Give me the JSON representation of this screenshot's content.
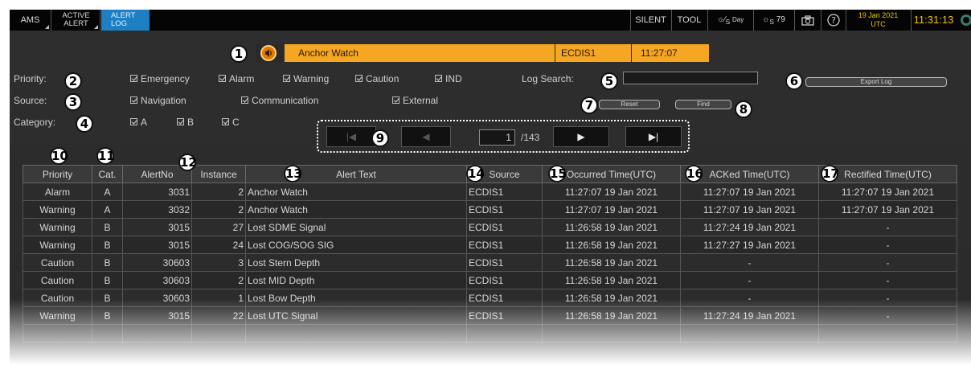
{
  "topbar": {
    "tabs": [
      {
        "label": "AMS"
      },
      {
        "label": "ACTIVE ALERT"
      },
      {
        "label": "ALERT LOG"
      }
    ],
    "silent_label": "SILENT",
    "tool_label": "TOOL",
    "day_label": "Day",
    "day_sub": "S",
    "brightness_value": "79",
    "brightness_sub": "S",
    "date": "19 Jan 2021",
    "tz": "UTC",
    "time": "11:31:13"
  },
  "latest_alert": {
    "text": "Anchor Watch",
    "source": "ECDIS1",
    "time": "11:27:07"
  },
  "filters": {
    "priority_label": "Priority:",
    "source_label": "Source:",
    "category_label": "Category:",
    "priority_options": [
      "Emergency",
      "Alarm",
      "Warning",
      "Caution",
      "IND"
    ],
    "source_options": [
      "Navigation",
      "Communication",
      "External"
    ],
    "category_options": [
      "A",
      "B",
      "C"
    ],
    "log_search_label": "Log Search:",
    "log_search_value": "",
    "export_label": "Export Log",
    "reset_label": "Reset",
    "find_label": "Find"
  },
  "pager": {
    "page": "1",
    "total": "/143",
    "first_glyph": "|◀",
    "prev_glyph": "◀",
    "next_glyph": "▶",
    "last_glyph": "▶|"
  },
  "callouts": [
    "1",
    "2",
    "3",
    "4",
    "5",
    "6",
    "7",
    "8",
    "9",
    "10",
    "11",
    "12",
    "13",
    "14",
    "15",
    "16",
    "17"
  ],
  "table": {
    "headers": [
      "Priority",
      "Cat.",
      "AlertNo",
      "Instance",
      "Alert Text",
      "Source",
      "Occurred Time(UTC)",
      "ACKed Time(UTC)",
      "Rectified Time(UTC)"
    ],
    "rows": [
      {
        "priority": "Alarm",
        "cat": "A",
        "alert_no": "3031",
        "instance": "2",
        "text": "Anchor Watch",
        "source": "ECDIS1",
        "occurred": "11:27:07 19 Jan 2021",
        "acked": "11:27:07 19 Jan 2021",
        "rectified": "11:27:07 19 Jan 2021"
      },
      {
        "priority": "Warning",
        "cat": "A",
        "alert_no": "3032",
        "instance": "2",
        "text": "Anchor Watch",
        "source": "ECDIS1",
        "occurred": "11:27:07 19 Jan 2021",
        "acked": "11:27:07 19 Jan 2021",
        "rectified": "11:27:07 19 Jan 2021"
      },
      {
        "priority": "Warning",
        "cat": "B",
        "alert_no": "3015",
        "instance": "27",
        "text": "Lost SDME Signal",
        "source": "ECDIS1",
        "occurred": "11:26:58 19 Jan 2021",
        "acked": "11:27:24 19 Jan 2021",
        "rectified": "-"
      },
      {
        "priority": "Warning",
        "cat": "B",
        "alert_no": "3015",
        "instance": "24",
        "text": "Lost COG/SOG SIG",
        "source": "ECDIS1",
        "occurred": "11:26:58 19 Jan 2021",
        "acked": "11:27:27 19 Jan 2021",
        "rectified": "-"
      },
      {
        "priority": "Caution",
        "cat": "B",
        "alert_no": "30603",
        "instance": "3",
        "text": "Lost Stern Depth",
        "source": "ECDIS1",
        "occurred": "11:26:58 19 Jan 2021",
        "acked": "-",
        "rectified": "-"
      },
      {
        "priority": "Caution",
        "cat": "B",
        "alert_no": "30603",
        "instance": "2",
        "text": "Lost MID Depth",
        "source": "ECDIS1",
        "occurred": "11:26:58 19 Jan 2021",
        "acked": "-",
        "rectified": "-"
      },
      {
        "priority": "Caution",
        "cat": "B",
        "alert_no": "30603",
        "instance": "1",
        "text": "Lost Bow Depth",
        "source": "ECDIS1",
        "occurred": "11:26:58 19 Jan 2021",
        "acked": "-",
        "rectified": "-"
      },
      {
        "priority": "Warning",
        "cat": "B",
        "alert_no": "3015",
        "instance": "22",
        "text": "Lost UTC Signal",
        "source": "ECDIS1",
        "occurred": "11:26:58 19 Jan 2021",
        "acked": "11:27:24 19 Jan 2021",
        "rectified": "-"
      },
      {
        "priority": "",
        "cat": "",
        "alert_no": "",
        "instance": "",
        "text": "",
        "source": "",
        "occurred": "",
        "acked": "",
        "rectified": ""
      }
    ]
  },
  "colors": {
    "panel_bg": "#2c2c2c",
    "alert_bar": "#f5a623",
    "tab_active": "#1f7fc4",
    "clock": "#f0c400"
  }
}
